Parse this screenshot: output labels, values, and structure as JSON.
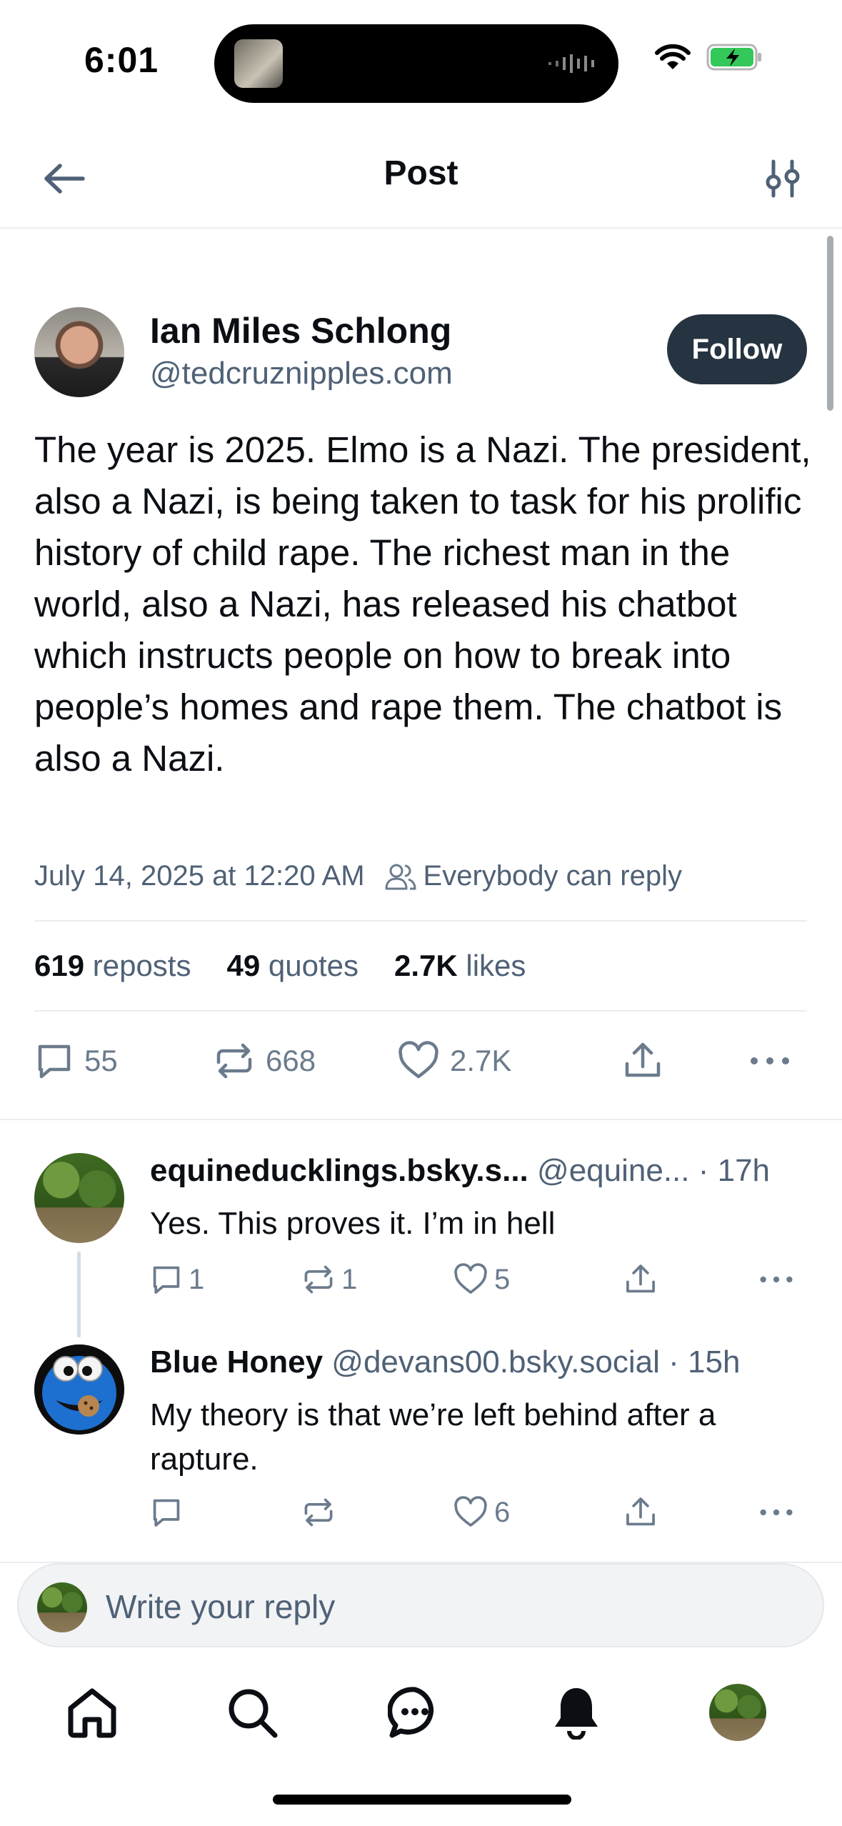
{
  "status_bar": {
    "time": "6:01"
  },
  "header": {
    "title": "Post"
  },
  "post": {
    "author_name": "Ian Miles Schlong",
    "author_handle": "@tedcruznipples.com",
    "follow_label": "Follow",
    "text": "The year is 2025. Elmo is a Nazi. The president, also a Nazi, is being taken to task for his prolific history of child rape. The richest man in the world, also a Nazi, has released his chatbot which instructs people on how to break into people’s homes and rape them. The chatbot is also a Nazi.",
    "timestamp": "July 14, 2025 at 12:20 AM",
    "reply_setting": "Everybody can reply",
    "stats": {
      "reposts_count": "619",
      "reposts_label": "reposts",
      "quotes_count": "49",
      "quotes_label": "quotes",
      "likes_count": "2.7K",
      "likes_label": "likes"
    },
    "actions": {
      "replies": "55",
      "reposts": "668",
      "likes": "2.7K"
    }
  },
  "replies": [
    {
      "name": "equineducklings.bsky.s...",
      "handle": "@equine...",
      "time": "· 17h",
      "text": "Yes. This proves it. I’m in hell",
      "replies": "1",
      "reposts": "1",
      "likes": "5"
    },
    {
      "name": "Blue Honey",
      "handle": "@devans00.bsky.social",
      "time": "· 15h",
      "text": "My theory is that we’re left behind after a rapture.",
      "replies": "",
      "reposts": "",
      "likes": "6"
    }
  ],
  "reply_bar": {
    "placeholder": "Write your reply"
  },
  "colors": {
    "accent_dark": "#263340",
    "muted_text": "#4f6176",
    "icon_gray": "#6b7b8c"
  },
  "icons": [
    "back-arrow-icon",
    "filter-sliders-icon",
    "reply-icon",
    "repost-icon",
    "heart-icon",
    "share-icon",
    "more-icon",
    "home-icon",
    "search-icon",
    "chat-icon",
    "bell-icon"
  ]
}
